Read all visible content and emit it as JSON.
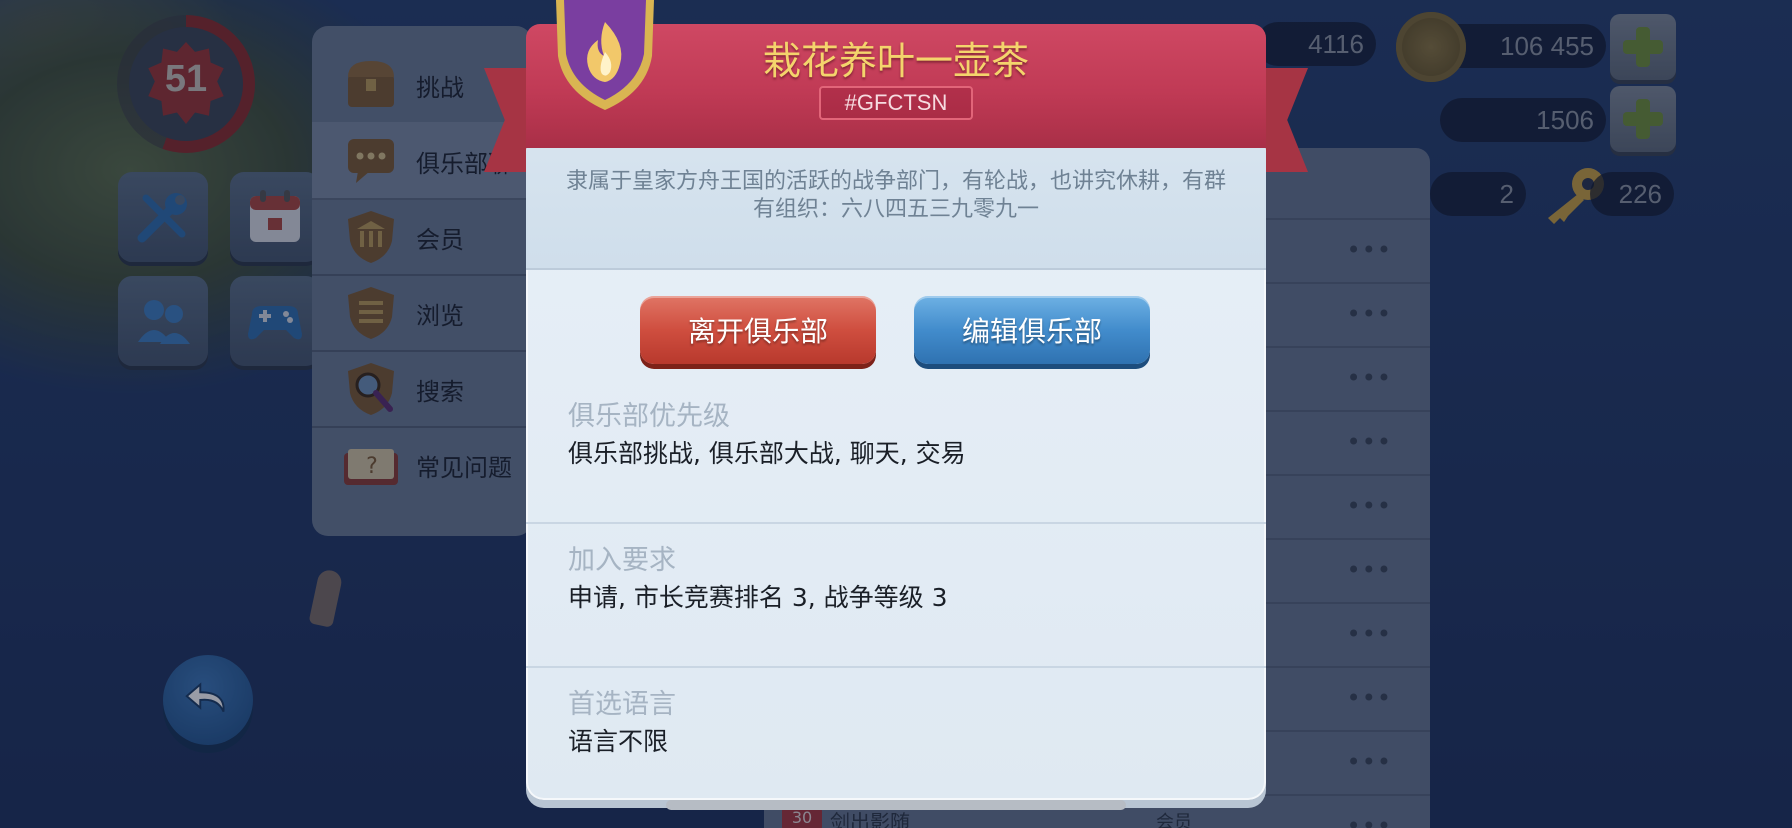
{
  "hud": {
    "level": "51",
    "partial_number": "4116",
    "coins": "106 455",
    "cash": "1506",
    "small_count": "2",
    "keys": "226"
  },
  "menu": {
    "items": [
      {
        "label": "挑战",
        "icon": "treasure-chest-icon"
      },
      {
        "label": "俱乐部聊",
        "icon": "chat-bubble-icon"
      },
      {
        "label": "会员",
        "icon": "bank-shield-icon"
      },
      {
        "label": "浏览",
        "icon": "list-shield-icon"
      },
      {
        "label": "搜索",
        "icon": "magnifier-shield-icon"
      },
      {
        "label": "常见问题",
        "icon": "faq-book-icon"
      }
    ]
  },
  "background_list": {
    "peek_rank": "30",
    "peek_name": "剑出影随",
    "peek_role": "会员",
    "row_menu": "•••"
  },
  "club": {
    "name": "栽花养叶一壶茶",
    "tag": "#GFCTSN",
    "description": "隶属于皇家方舟王国的活跃的战争部门，有轮战，也讲究休耕，有群有组织：六八四五三九零九一",
    "leave_button": "离开俱乐部",
    "edit_button": "编辑俱乐部",
    "priority_title": "俱乐部优先级",
    "priority_value": "俱乐部挑战, 俱乐部大战, 聊天, 交易",
    "requirements_title": "加入要求",
    "requirements_value": "申请, 市长竞赛排名 3, 战争等级 3",
    "language_title": "首选语言",
    "language_value": "语言不限"
  },
  "colors": {
    "ribbon": "#c03a55",
    "title_gold": "#f4d46c",
    "leave_red": "#cf4e3f",
    "edit_blue": "#428ccc",
    "dialog_bg": "#e3ecf5"
  }
}
